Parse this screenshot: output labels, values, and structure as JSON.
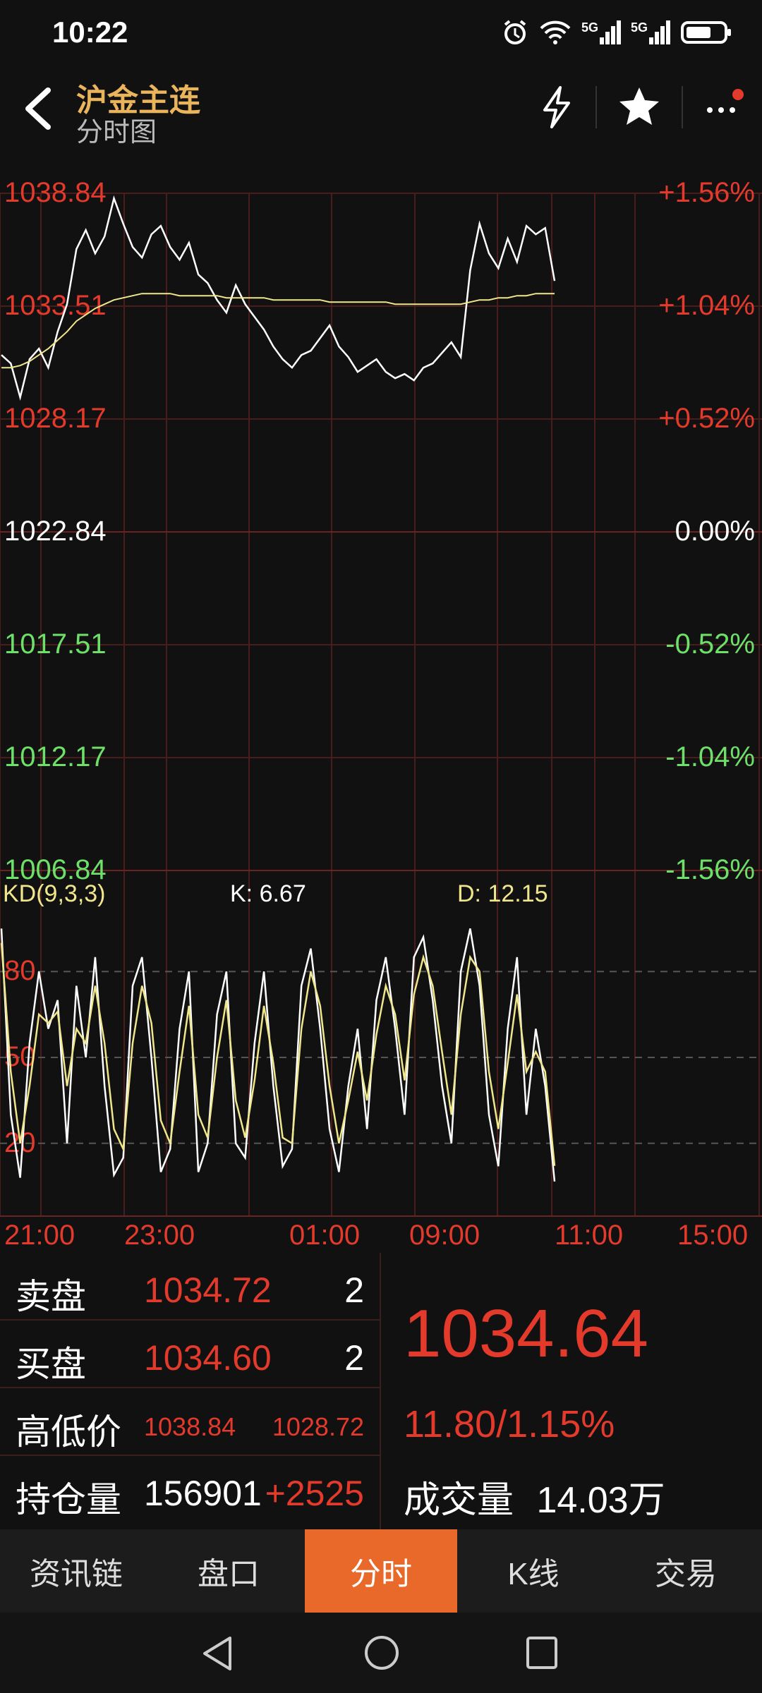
{
  "status_bar": {
    "time": "10:22",
    "signal1": "5G",
    "signal2": "5G"
  },
  "header": {
    "title": "沪金主连",
    "subtitle": "分时图"
  },
  "price_axis": {
    "left": [
      "1038.84",
      "1033.51",
      "1028.17",
      "1022.84",
      "1017.51",
      "1012.17",
      "1006.84"
    ],
    "right": [
      "+1.56%",
      "+1.04%",
      "+0.52%",
      "0.00%",
      "-0.52%",
      "-1.04%",
      "-1.56%"
    ]
  },
  "indicator": {
    "name": "KD(9,3,3)",
    "k_label": "K: 6.67",
    "d_label": "D: 12.15",
    "levels": [
      "80",
      "50",
      "20"
    ]
  },
  "time_axis": [
    "21:00",
    "23:00",
    "01:00",
    "09:00",
    "11:00",
    "15:00"
  ],
  "colors": {
    "up": "#e33a2c",
    "down": "#6ee06a",
    "avg_line": "#f0e68c",
    "price_line": "#ffffff",
    "accent": "#e8692a",
    "title": "#e9b45b"
  },
  "chart_data": [
    {
      "type": "line",
      "title": "",
      "x_ticks": [
        "21:00",
        "23:00",
        "01:00",
        "09:00",
        "11:00",
        "15:00"
      ],
      "ylim": [
        1006.84,
        1038.84
      ],
      "series": [
        {
          "values": [
            1031.2,
            1030.8,
            1029.2,
            1031.0,
            1031.5,
            1030.6,
            1032.3,
            1033.6,
            1036.2,
            1037.1,
            1036.0,
            1036.8,
            1038.6,
            1037.4,
            1036.3,
            1035.8,
            1036.9,
            1037.3,
            1036.3,
            1035.7,
            1036.5,
            1035.0,
            1034.6,
            1033.8,
            1033.2,
            1034.5,
            1033.6,
            1033.0,
            1032.4,
            1031.6,
            1031.0,
            1030.6,
            1031.2,
            1031.4,
            1032.0,
            1032.6,
            1031.6,
            1031.1,
            1030.4,
            1030.7,
            1031.0,
            1030.4,
            1030.1,
            1030.3,
            1030.0,
            1030.6,
            1030.8,
            1031.3,
            1031.8,
            1031.1,
            1035.2,
            1037.4,
            1036.0,
            1035.3,
            1036.7,
            1035.6,
            1037.3,
            1036.9,
            1037.2,
            1034.7
          ]
        },
        {
          "values": [
            1030.6,
            1030.6,
            1030.7,
            1030.9,
            1031.2,
            1031.5,
            1031.9,
            1032.3,
            1032.8,
            1033.1,
            1033.4,
            1033.6,
            1033.8,
            1033.9,
            1034.0,
            1034.1,
            1034.1,
            1034.1,
            1034.1,
            1034.0,
            1034.0,
            1034.0,
            1034.0,
            1034.0,
            1033.9,
            1033.9,
            1033.9,
            1033.9,
            1033.9,
            1033.8,
            1033.8,
            1033.8,
            1033.8,
            1033.8,
            1033.8,
            1033.7,
            1033.7,
            1033.7,
            1033.7,
            1033.7,
            1033.7,
            1033.7,
            1033.6,
            1033.6,
            1033.6,
            1033.6,
            1033.6,
            1033.6,
            1033.6,
            1033.6,
            1033.7,
            1033.8,
            1033.8,
            1033.9,
            1033.9,
            1034.0,
            1034.0,
            1034.1,
            1034.1,
            1034.1
          ]
        }
      ]
    },
    {
      "type": "line",
      "title": "",
      "ylim": [
        0,
        100
      ],
      "series": [
        {
          "name": "K",
          "values": [
            95,
            30,
            8,
            55,
            80,
            60,
            70,
            20,
            75,
            50,
            85,
            40,
            9,
            15,
            75,
            85,
            50,
            10,
            18,
            60,
            80,
            10,
            20,
            65,
            80,
            20,
            15,
            55,
            80,
            40,
            12,
            18,
            75,
            88,
            60,
            25,
            10,
            40,
            60,
            25,
            70,
            85,
            60,
            30,
            85,
            92,
            70,
            40,
            20,
            80,
            95,
            75,
            30,
            12,
            60,
            85,
            30,
            60,
            40,
            6.67
          ]
        },
        {
          "name": "D",
          "values": [
            90,
            45,
            20,
            40,
            65,
            62,
            66,
            40,
            60,
            55,
            75,
            55,
            25,
            18,
            55,
            75,
            62,
            28,
            20,
            45,
            68,
            30,
            22,
            50,
            70,
            35,
            22,
            42,
            68,
            48,
            22,
            20,
            60,
            80,
            68,
            40,
            20,
            35,
            52,
            35,
            58,
            75,
            65,
            42,
            72,
            85,
            75,
            52,
            30,
            65,
            85,
            80,
            45,
            25,
            48,
            72,
            45,
            52,
            45,
            12.15
          ]
        }
      ]
    }
  ],
  "summary": {
    "sell_label": "卖盘",
    "sell_price": "1034.72",
    "sell_qty": "2",
    "buy_label": "买盘",
    "buy_price": "1034.60",
    "buy_qty": "2",
    "hl_label": "高低价",
    "high": "1038.84",
    "low": "1028.72",
    "oi_label": "持仓量",
    "oi": "156901",
    "oi_change": "+2525",
    "last_price": "1034.64",
    "change": "11.80/1.15%",
    "volume_label": "成交量",
    "volume": "14.03万"
  },
  "tabs": [
    {
      "label": "资讯链",
      "active": false
    },
    {
      "label": "盘口",
      "active": false
    },
    {
      "label": "分时",
      "active": true
    },
    {
      "label": "K线",
      "active": false
    },
    {
      "label": "交易",
      "active": false
    }
  ]
}
